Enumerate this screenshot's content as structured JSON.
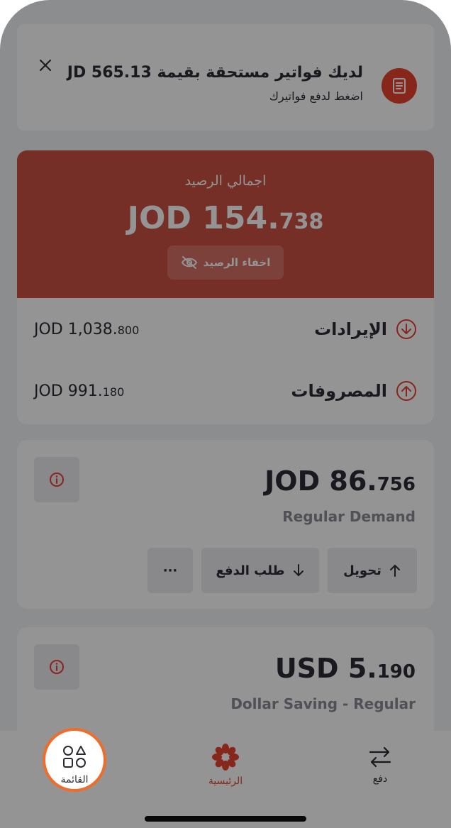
{
  "bill_banner": {
    "title": "لديك فواتير مستحقة بقيمة JD 565.13",
    "subtitle": "اضغط لدفع فواتيرك"
  },
  "balance": {
    "label": "اجمالي الرصيد",
    "currency": "JOD",
    "whole": "154.",
    "decimal": "738",
    "hide_label": "اخفاء الرصيد"
  },
  "summary": {
    "income": {
      "label": "الإيرادات",
      "currency": "JOD",
      "whole": "1,038.",
      "decimal": "800"
    },
    "expenses": {
      "label": "المصروفات",
      "currency": "JOD",
      "whole": "991.",
      "decimal": "180"
    }
  },
  "accounts": [
    {
      "currency": "JOD",
      "whole": "86.",
      "decimal": "756",
      "name": "Regular Demand",
      "actions": {
        "transfer_label": "تحويل",
        "request_label": "طلب الدفع",
        "more_label": "···"
      }
    },
    {
      "currency": "USD",
      "whole": "5.",
      "decimal": "190",
      "name": "Dollar Saving - Regular"
    }
  ],
  "bottom_nav": {
    "menu_label": "القائمة",
    "home_label": "الرئيسية",
    "pay_label": "دفع"
  },
  "colors": {
    "brand": "#e8432f",
    "card_red": "#cc5242",
    "highlight": "#f06c2a"
  }
}
